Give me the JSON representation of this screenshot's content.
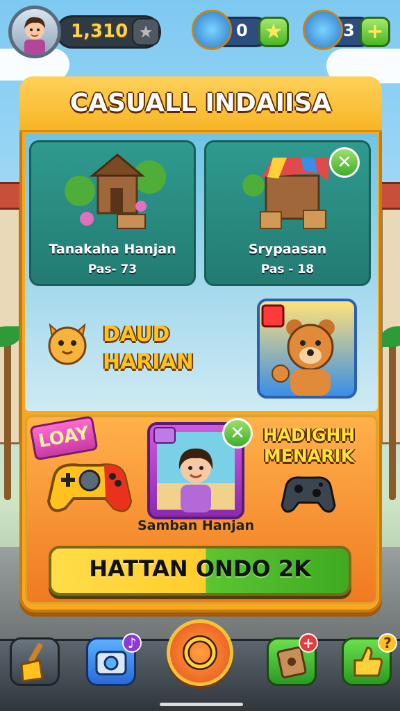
{
  "player": {
    "coins": "1,310",
    "gems": "0",
    "lives": "3"
  },
  "panel": {
    "title": "CASUALL INDAIISA"
  },
  "cards": [
    {
      "name": "Tanakaha Hanjan",
      "sub": "Pas- 73"
    },
    {
      "name": "Srypaasan",
      "sub": "Pas - 18"
    }
  ],
  "daily": {
    "line1": "DAUD",
    "line2": "HARIAN"
  },
  "rewards": {
    "badge": "LOAY",
    "title_line1": "HADIGHH",
    "title_line2": "MENARIK",
    "photo_label": "Samban Hanjan",
    "cta": "HATTAN ONDO 2K"
  },
  "colors": {
    "panel_orange": "#f6a821",
    "card_teal": "#2f9a8e",
    "cta_yellow": "#ffcd2a",
    "cta_green": "#3faa22"
  },
  "icons": {
    "top": [
      "player-avatar",
      "star-icon",
      "gem-hand-icon",
      "lives-glove-icon",
      "plus-icon"
    ],
    "bottom": [
      "broom-icon",
      "camera-icon",
      "play-ring-icon",
      "map-scroll-icon",
      "thumbs-up-icon"
    ]
  }
}
